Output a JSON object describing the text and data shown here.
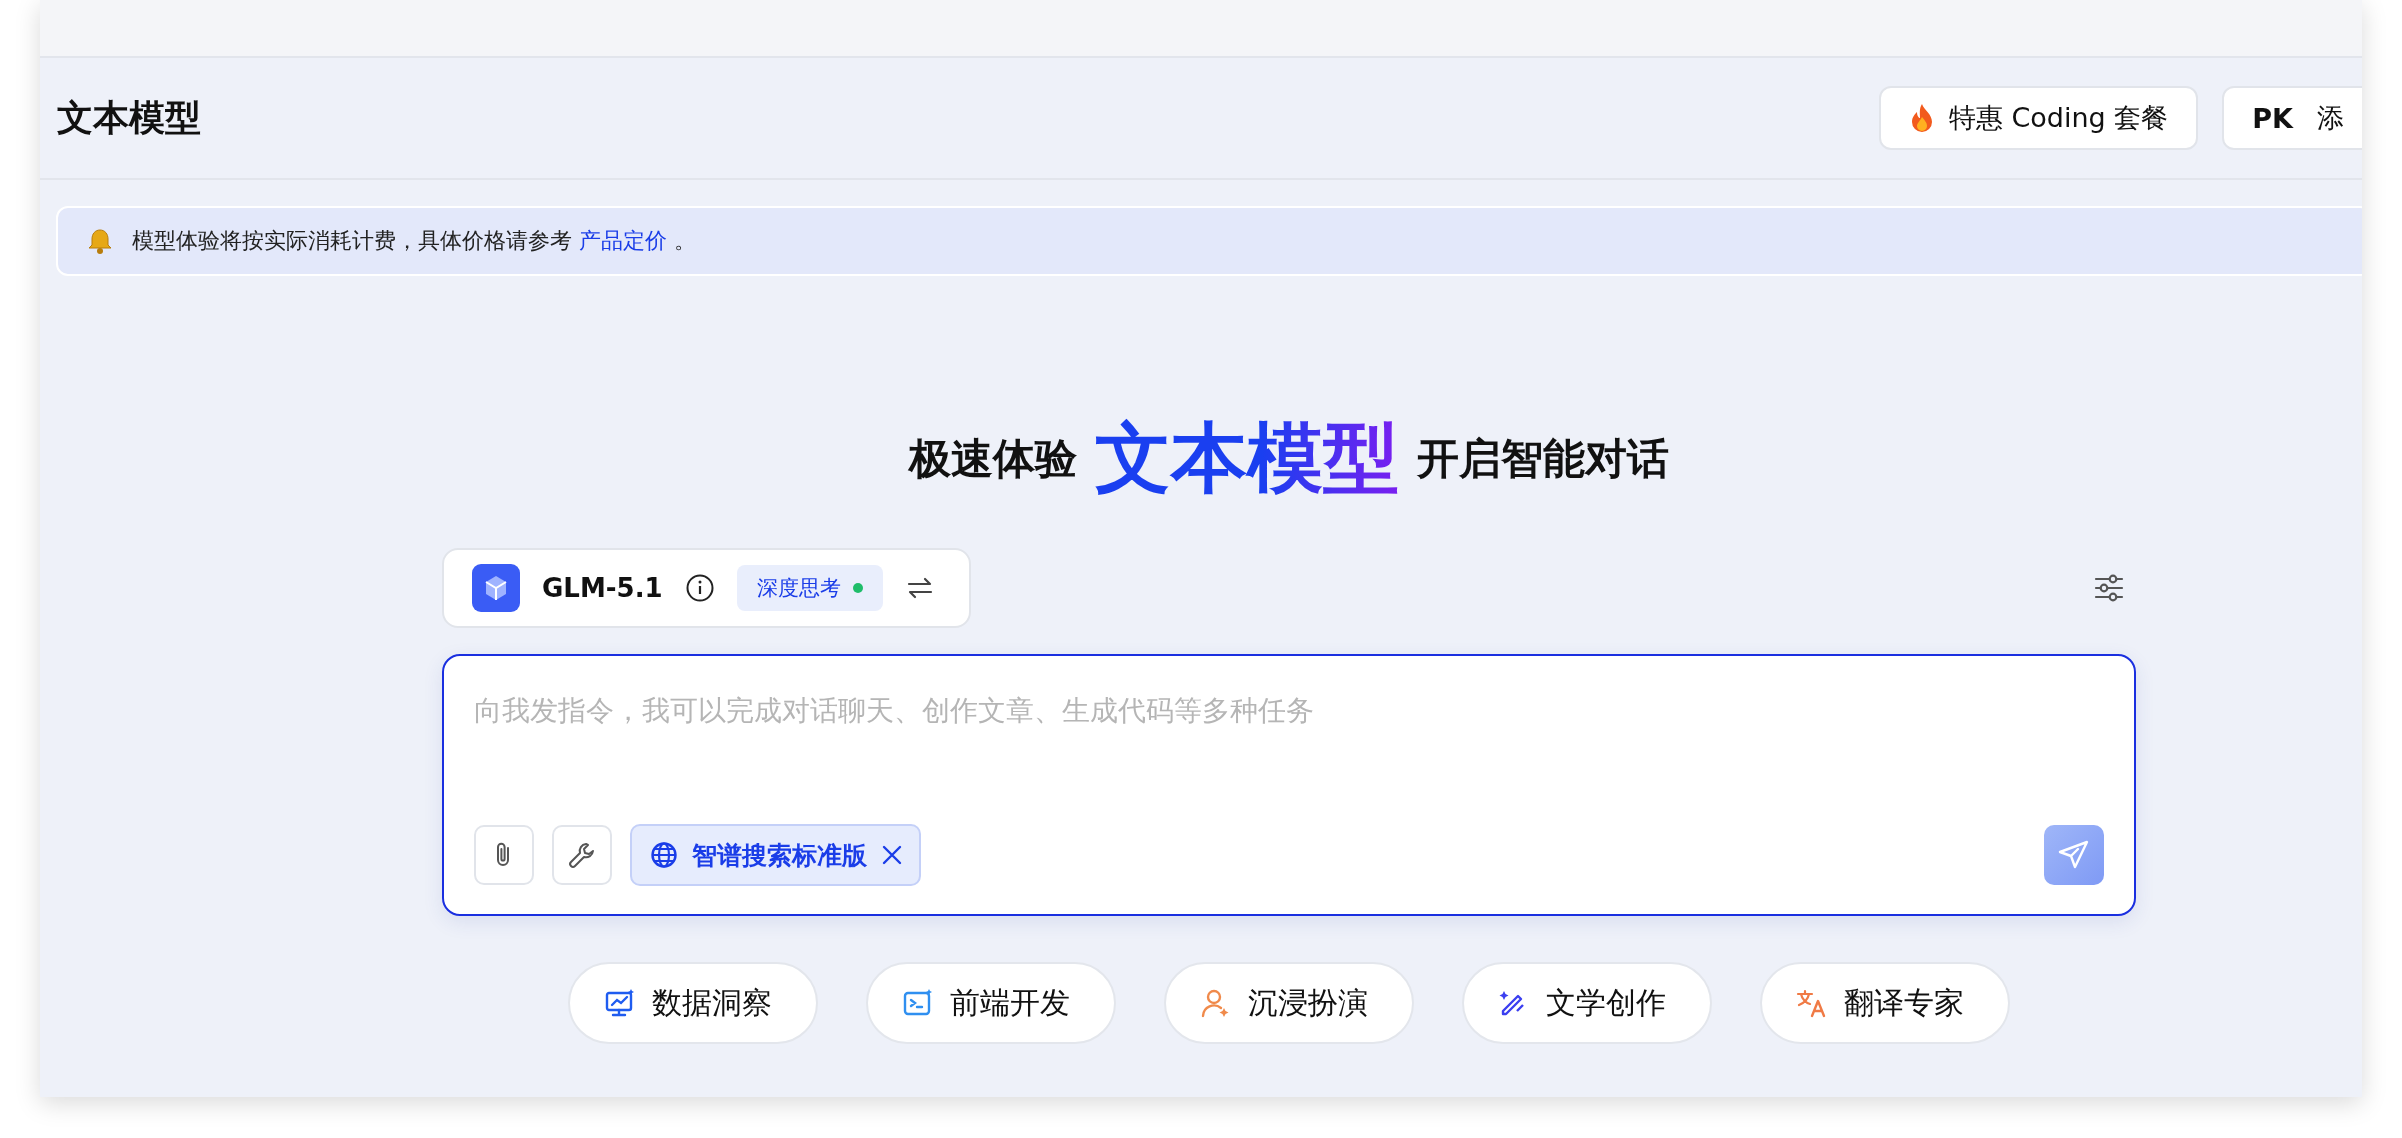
{
  "header": {
    "title": "文本模型",
    "buttons": [
      {
        "kind": "promo",
        "label": "特惠 Coding 套餐"
      },
      {
        "kind": "pk",
        "badge": "PK",
        "label": "添"
      }
    ]
  },
  "notice": {
    "text": "模型体验将按实际消耗计费，具体价格请参考",
    "link": "产品定价",
    "tail": "。"
  },
  "headline": [
    {
      "kind": "plain",
      "text": "极速体验"
    },
    {
      "kind": "gradient",
      "text": "文本模型"
    },
    {
      "kind": "plain",
      "text": "开启智能对话"
    }
  ],
  "model_bar": {
    "model": "GLM-5.1",
    "thinking": {
      "label": "深度思考",
      "on": true
    }
  },
  "composer": {
    "placeholder": "向我发指令，我可以完成对话聊天、创作文章、生成代码等多种任务",
    "search_tag": "智谱搜索标准版",
    "send_disabled": true
  },
  "suggestions": [
    {
      "kind": "chart",
      "label": "数据洞察",
      "color": "#1f5cf0"
    },
    {
      "kind": "terminal",
      "label": "前端开发",
      "color": "#2f8ff0"
    },
    {
      "kind": "person",
      "label": "沉浸扮演",
      "color": "#f08a4b"
    },
    {
      "kind": "pen",
      "label": "文学创作",
      "color": "#3b3ff0"
    },
    {
      "kind": "translate",
      "label": "翻译专家",
      "color": "#f07a45"
    }
  ]
}
